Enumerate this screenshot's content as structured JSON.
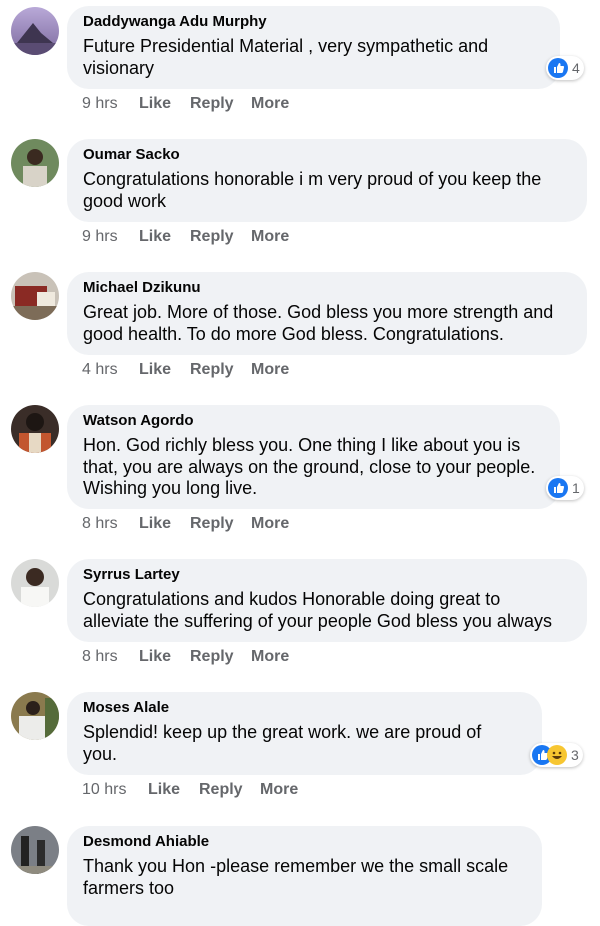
{
  "comments": [
    {
      "author": "Daddywanga Adu Murphy",
      "text": "Future Presidential Material , very sympathetic and visionary",
      "time": "9 hrs",
      "reaction_count": "4",
      "reactions": [
        "like-icon"
      ]
    },
    {
      "author": "Oumar Sacko",
      "text": "Congratulations honorable i m very proud of you keep the good work",
      "time": "9 hrs",
      "reaction_count": "",
      "reactions": []
    },
    {
      "author": "Michael Dzikunu",
      "text": "Great job. More of those. God bless you more strength and good health. To do more God bless. Congratulations.",
      "time": "4 hrs",
      "reaction_count": "",
      "reactions": []
    },
    {
      "author": "Watson Agordo",
      "text": "Hon. God richly bless you. One thing I like about you is that, you are always on the ground, close to your people. Wishing you long live.",
      "time": "8 hrs",
      "reaction_count": "1",
      "reactions": [
        "like-icon"
      ]
    },
    {
      "author": "Syrrus Lartey",
      "text": "Congratulations and kudos Honorable doing great to alleviate the suffering of your people God bless you always",
      "time": "8 hrs",
      "reaction_count": "",
      "reactions": []
    },
    {
      "author": "Moses Alale",
      "text": "Splendid! keep up the great work. we are proud of you.",
      "time": "10 hrs",
      "reaction_count": "3",
      "reactions": [
        "like-icon",
        "haha-icon"
      ]
    },
    {
      "author": "Desmond Ahiable",
      "text": "Thank you Hon -please remember we the small scale farmers too",
      "time": "",
      "reaction_count": "",
      "reactions": []
    }
  ],
  "actions": {
    "like": "Like",
    "reply": "Reply",
    "more": "More"
  },
  "colors": {
    "bubble": "#f0f2f5",
    "meta": "#65676b",
    "like_blue": "#1a77f2"
  }
}
